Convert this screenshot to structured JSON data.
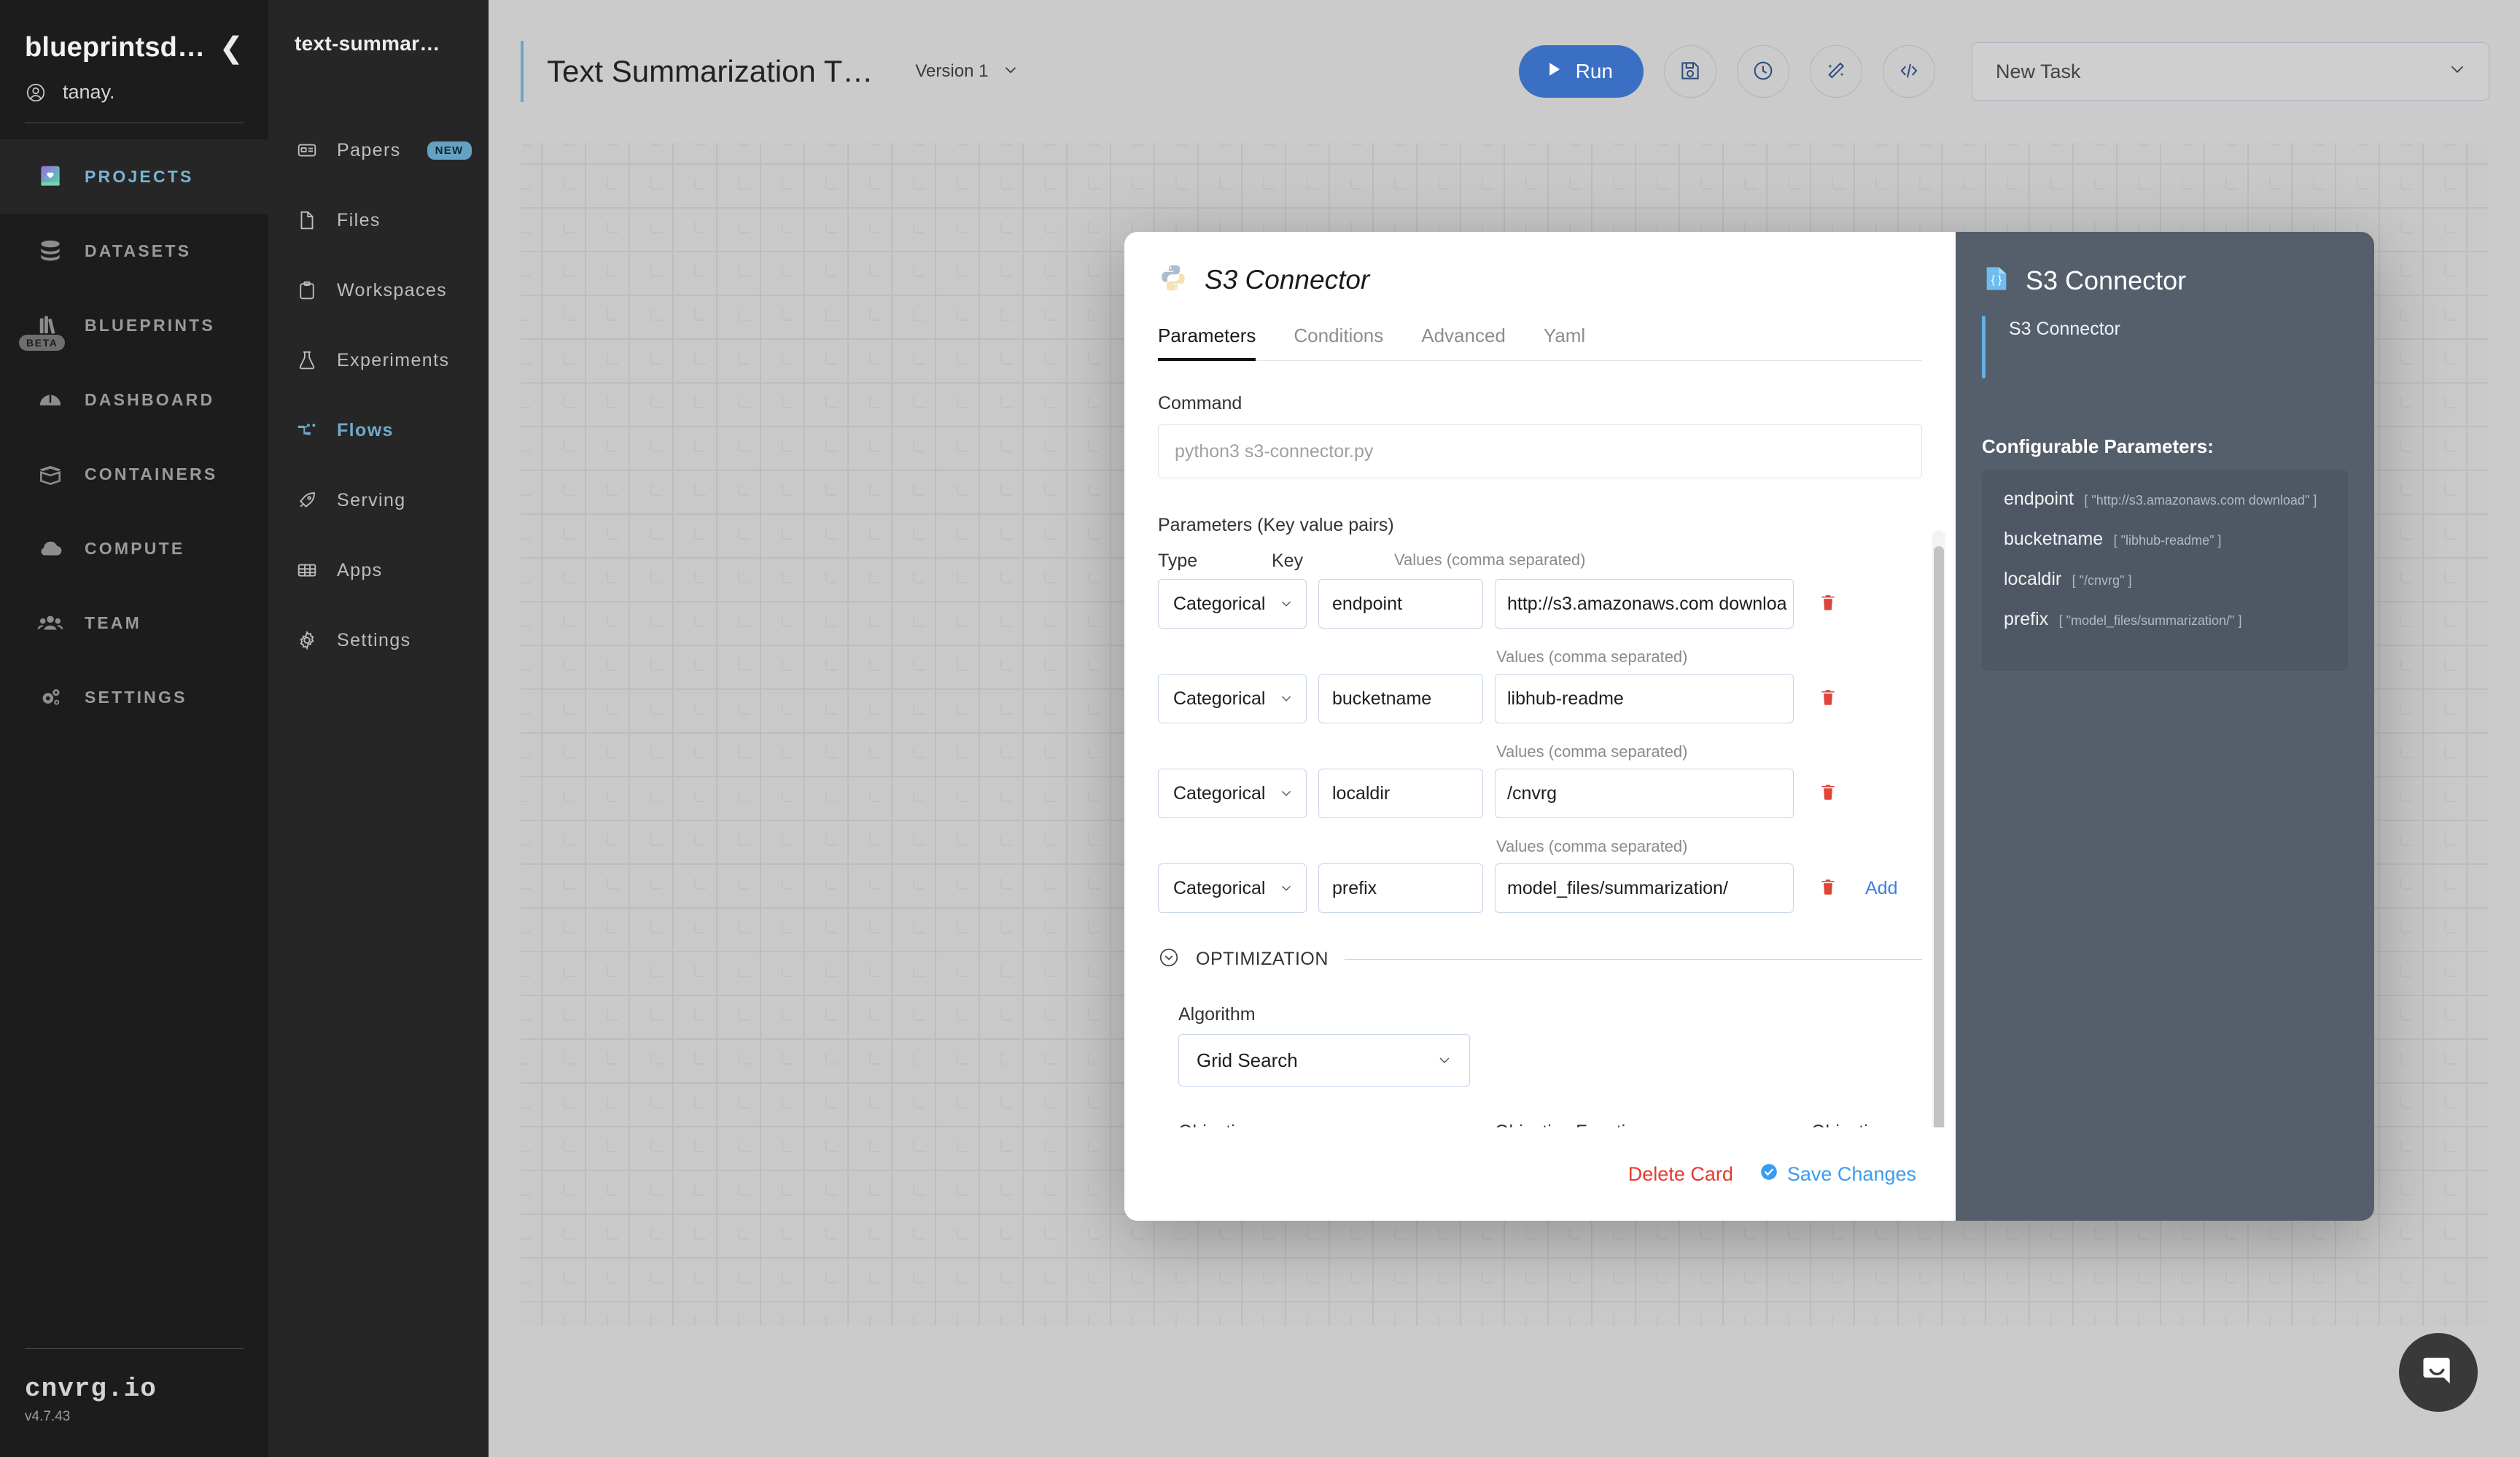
{
  "sidebar_primary": {
    "org": "blueprintsd…",
    "user": "tanay.",
    "collapse_icon": "chevron-left-icon",
    "items": [
      {
        "label": "PROJECTS",
        "icon": "book-heart-icon",
        "active": true,
        "badge": ""
      },
      {
        "label": "DATASETS",
        "icon": "database-icon",
        "active": false,
        "badge": ""
      },
      {
        "label": "BLUEPRINTS",
        "icon": "books-icon",
        "active": false,
        "badge": "BETA"
      },
      {
        "label": "DASHBOARD",
        "icon": "gauge-icon",
        "active": false,
        "badge": ""
      },
      {
        "label": "CONTAINERS",
        "icon": "box-icon",
        "active": false,
        "badge": ""
      },
      {
        "label": "COMPUTE",
        "icon": "cloud-icon",
        "active": false,
        "badge": ""
      },
      {
        "label": "TEAM",
        "icon": "people-icon",
        "active": false,
        "badge": ""
      },
      {
        "label": "SETTINGS",
        "icon": "gears-icon",
        "active": false,
        "badge": ""
      }
    ],
    "brand": "cnvrg.io",
    "version": "v4.7.43"
  },
  "sidebar_secondary": {
    "project_title": "text-summar…",
    "items": [
      {
        "label": "Papers",
        "icon": "paper-icon",
        "badge": "NEW",
        "active": false
      },
      {
        "label": "Files",
        "icon": "file-icon",
        "badge": "",
        "active": false
      },
      {
        "label": "Workspaces",
        "icon": "clipboard-icon",
        "badge": "",
        "active": false
      },
      {
        "label": "Experiments",
        "icon": "flask-icon",
        "badge": "",
        "active": false
      },
      {
        "label": "Flows",
        "icon": "flow-icon",
        "badge": "",
        "active": true
      },
      {
        "label": "Serving",
        "icon": "rocket-icon",
        "badge": "",
        "active": false
      },
      {
        "label": "Apps",
        "icon": "grid-icon",
        "badge": "",
        "active": false
      },
      {
        "label": "Settings",
        "icon": "gear-icon",
        "badge": "",
        "active": false
      }
    ]
  },
  "topbar": {
    "title": "Text Summarization T…",
    "version": "Version 1",
    "run_label": "Run",
    "icon_buttons": [
      "save-icon",
      "clock-icon",
      "magic-wand-icon",
      "code-icon"
    ],
    "task_select": "New Task"
  },
  "modal": {
    "title": "S3 Connector",
    "title_icon": "python-icon",
    "tabs": [
      {
        "label": "Parameters",
        "active": true
      },
      {
        "label": "Conditions",
        "active": false
      },
      {
        "label": "Advanced",
        "active": false
      },
      {
        "label": "Yaml",
        "active": false
      }
    ],
    "command_label": "Command",
    "command_placeholder": "python3 s3-connector.py",
    "params_section_label": "Parameters (Key value pairs)",
    "col_type": "Type",
    "col_key": "Key",
    "col_values": "Values (comma separated)",
    "rows": [
      {
        "type": "Categorical",
        "key": "endpoint",
        "value": "http://s3.amazonaws.com downloa"
      },
      {
        "type": "Categorical",
        "key": "bucketname",
        "value": "libhub-readme"
      },
      {
        "type": "Categorical",
        "key": "localdir",
        "value": "/cnvrg"
      },
      {
        "type": "Categorical",
        "key": "prefix",
        "value": "model_files/summarization/"
      }
    ],
    "add_label": "Add",
    "optimization_label": "OPTIMIZATION",
    "algorithm_label": "Algorithm",
    "algorithm_value": "Grid Search",
    "objective_label": "Objective",
    "objective_value": "",
    "objective_function_label": "Objective Function",
    "objective_function_value": "",
    "objective_goal_label": "Objective Goal",
    "objective_goal_value": "",
    "delete_label": "Delete Card",
    "save_label": "Save Changes"
  },
  "info_panel": {
    "title": "S3 Connector",
    "title_icon": "json-file-icon",
    "description": "S3 Connector",
    "configurable_label": "Configurable Parameters:",
    "params": [
      {
        "name": "endpoint",
        "value": "[ \"http://s3.amazonaws.com download\" ]"
      },
      {
        "name": "bucketname",
        "value": "[ \"libhub-readme\" ]"
      },
      {
        "name": "localdir",
        "value": "[ \"/cnvrg\" ]"
      },
      {
        "name": "prefix",
        "value": "[ \"model_files/summarization/\" ]"
      }
    ]
  },
  "chat": {
    "icon": "chat-bubble-icon"
  },
  "colors": {
    "accent_blue": "#3a6fc4",
    "link_blue": "#3a7ee8",
    "danger_red": "#e8392e",
    "panel_dark": "#555e6b",
    "sidebar_dark": "#1c1c1c"
  }
}
